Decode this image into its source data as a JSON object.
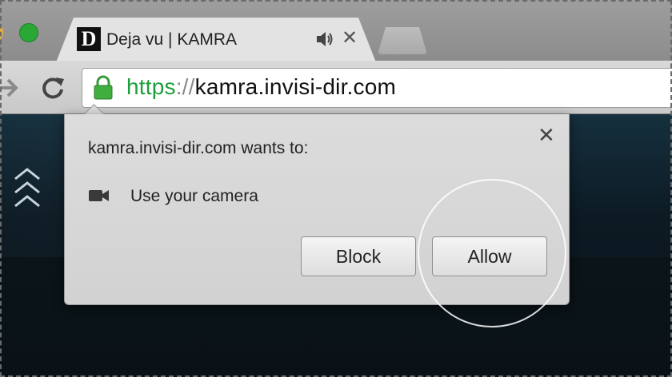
{
  "tab": {
    "favicon_letter": "D",
    "title": "Deja vu | KAMRA",
    "close_symbol": "✕"
  },
  "omnibox": {
    "scheme": "https",
    "separator": "://",
    "host": "kamra.invisi-dir.com"
  },
  "permission_bubble": {
    "heading": "kamra.invisi-dir.com wants to:",
    "permission": "Use your camera",
    "close_symbol": "✕",
    "block_label": "Block",
    "allow_label": "Allow"
  },
  "colors": {
    "secure_green": "#1d9e3a",
    "traffic_green": "#2aa836",
    "page_background": "#0e1a22"
  },
  "icons": [
    "forward-icon",
    "reload-icon",
    "lock-icon",
    "speaker-icon",
    "camera-icon",
    "chevrons-up-icon"
  ]
}
